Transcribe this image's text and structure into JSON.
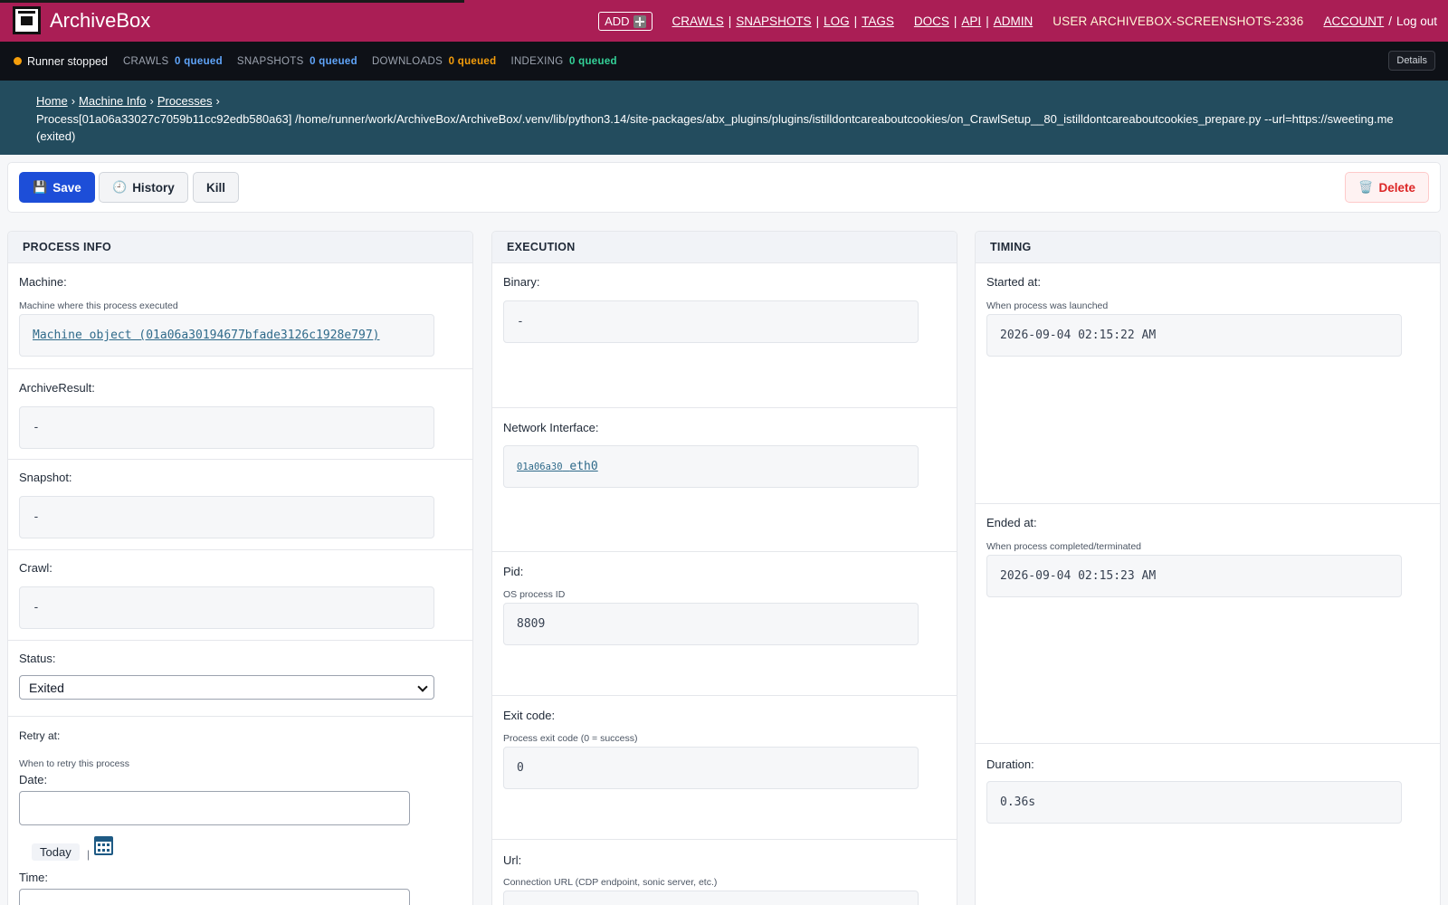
{
  "header": {
    "brand": "ArchiveBox",
    "add_label": "ADD",
    "nav": {
      "crawls": "CRAWLS",
      "snapshots": "SNAPSHOTS",
      "log": "LOG",
      "tags": "TAGS",
      "docs": "DOCS",
      "api": "API",
      "admin": "ADMIN",
      "user": "USER ARCHIVEBOX-SCREENSHOTS-2336",
      "account": "ACCOUNT",
      "logout": "Log out",
      "sep_pipe": "|",
      "sep_slash": "/"
    }
  },
  "runner": {
    "status": "Runner stopped",
    "queues": [
      {
        "label": "CRAWLS",
        "value": "0 queued",
        "color": "#60a5fa"
      },
      {
        "label": "SNAPSHOTS",
        "value": "0 queued",
        "color": "#60a5fa"
      },
      {
        "label": "DOWNLOADS",
        "value": "0 queued",
        "color": "#f59e0b"
      },
      {
        "label": "INDEXING",
        "value": "0 queued",
        "color": "#34d399"
      }
    ],
    "details_label": "Details"
  },
  "breadcrumb": {
    "home": "Home",
    "machine_info": "Machine Info",
    "processes": "Processes",
    "arrow": "›",
    "current": "Process[01a06a33027c7059b11cc92edb580a63] /home/runner/work/ArchiveBox/ArchiveBox/.venv/lib/python3.14/site-packages/abx_plugins/plugins/istilldontcareaboutcookies/on_CrawlSetup__80_istilldontcareaboutcookies_prepare.py --url=https://sweeting.me (exited)"
  },
  "toolbar": {
    "save_label": "Save",
    "history_label": "History",
    "kill_label": "Kill",
    "delete_label": "Delete"
  },
  "process_info": {
    "title": "PROCESS INFO",
    "machine_label": "Machine:",
    "machine_help": "Machine where this process executed",
    "machine_value": "Machine object (01a06a30194677bfade3126c1928e797)",
    "archiveresult_label": "ArchiveResult:",
    "archiveresult_value": "-",
    "snapshot_label": "Snapshot:",
    "snapshot_value": "-",
    "crawl_label": "Crawl:",
    "crawl_value": "-",
    "status_label": "Status:",
    "status_value": "Exited",
    "retry_label": "Retry at:",
    "retry_help": "When to retry this process",
    "date_label": "Date:",
    "today_label": "Today",
    "pipe": "|",
    "time_label": "Time:"
  },
  "execution": {
    "title": "EXECUTION",
    "binary_label": "Binary:",
    "binary_value": "-",
    "iface_label": "Network Interface:",
    "iface_id": "01a06a30",
    "iface_name": "eth0",
    "pid_label": "Pid:",
    "pid_help": "OS process ID",
    "pid_value": "8809",
    "exit_label": "Exit code:",
    "exit_help": "Process exit code (0 = success)",
    "exit_value": "0",
    "url_label": "Url:",
    "url_help": "Connection URL (CDP endpoint, sonic server, etc.)"
  },
  "timing": {
    "title": "TIMING",
    "started_label": "Started at:",
    "started_help": "When process was launched",
    "started_value": "2026-09-04 02:15:22 AM",
    "ended_label": "Ended at:",
    "ended_help": "When process completed/terminated",
    "ended_value": "2026-09-04 02:15:23 AM",
    "duration_label": "Duration:",
    "duration_value": "0.36s"
  }
}
